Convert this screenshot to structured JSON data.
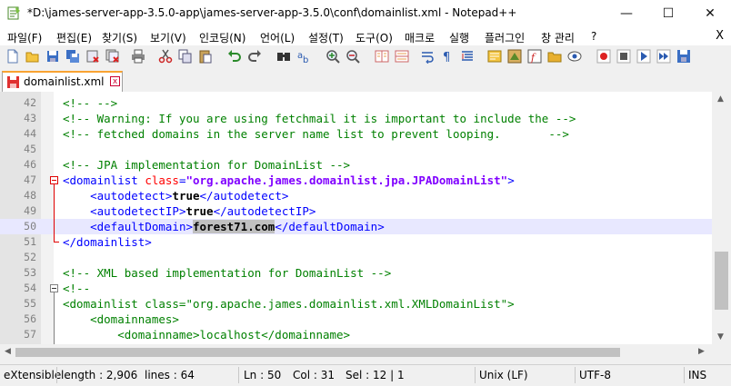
{
  "window": {
    "title": "*D:\\james-server-app-3.5.0-app\\james-server-app-3.5.0\\conf\\domainlist.xml - Notepad++",
    "buttons": {
      "minimize": "—",
      "maximize": "☐",
      "close": "✕"
    }
  },
  "menu": {
    "items": [
      "파일(F)",
      "편집(E)",
      "찾기(S)",
      "보기(V)",
      "인코딩(N)",
      "언어(L)",
      "설정(T)",
      "도구(O)",
      "매크로",
      "실행",
      "플러그인",
      "창 관리",
      "?"
    ],
    "close_label": "X"
  },
  "tab": {
    "label": "domainlist.xml",
    "close": "x"
  },
  "editor": {
    "line_numbers": [
      "42",
      "43",
      "44",
      "45",
      "46",
      "47",
      "48",
      "49",
      "50",
      "51",
      "52",
      "53",
      "54",
      "55",
      "56",
      "57"
    ],
    "current_line": 50
  },
  "status": {
    "file_type": "eXtensible",
    "length": "length : 2,906",
    "lines": "lines : 64",
    "ln": "Ln : 50",
    "col": "Col : 31",
    "sel": "Sel : 12 | 1",
    "eol": "Unix (LF)",
    "encoding": "UTF-8",
    "mode": "INS"
  },
  "colors": {
    "comment": "#008000",
    "tag": "#0000ff",
    "attribute": "#ff0000",
    "value": "#8000ff",
    "current_line": "#e8e8ff",
    "tab_accent": "#f9a332"
  }
}
